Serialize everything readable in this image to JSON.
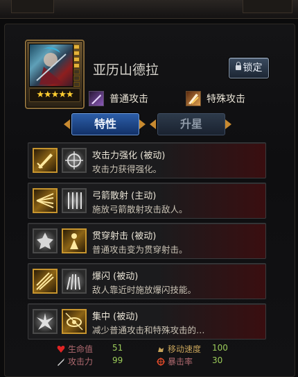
{
  "hero": {
    "name": "亚历山德拉",
    "stars": "★★★★★",
    "level_pips_on": 4,
    "lock_label": "锁定"
  },
  "attack_types": {
    "normal": {
      "label": "普通攻击",
      "icon": "normal-attack-icon"
    },
    "special": {
      "label": "特殊攻击",
      "icon": "special-attack-icon"
    }
  },
  "tabs": [
    {
      "label": "特性",
      "active": true
    },
    {
      "label": "升星",
      "active": false
    }
  ],
  "skills": [
    {
      "name": "攻击力强化 (被动)",
      "desc": "攻击力获得强化。",
      "icon_a": "sword-icon",
      "icon_b": "crosshair-icon"
    },
    {
      "name": "弓箭散射 (主动)",
      "desc": "施放弓箭散射攻击敌人。",
      "icon_a": "arrow-spread-icon",
      "icon_b": "arrow-rain-icon"
    },
    {
      "name": "贯穿射击 (被动)",
      "desc": "普通攻击变为贯穿射击。",
      "icon_a": "shatter-icon",
      "icon_b": "archer-icon"
    },
    {
      "name": "爆闪 (被动)",
      "desc": "敌人靠近时施放爆闪技能。",
      "icon_a": "flash-arrow-icon",
      "icon_b": "burst-icon"
    },
    {
      "name": "集中 (被动)",
      "desc": "减少普通攻击和特殊攻击的…",
      "icon_a": "explosion-icon",
      "icon_b": "eye-focus-icon"
    }
  ],
  "stats": {
    "hp": {
      "label": "生命值",
      "value": "51"
    },
    "atk": {
      "label": "攻击力",
      "value": "99"
    },
    "speed": {
      "label": "移动速度",
      "value": "100"
    },
    "crit": {
      "label": "暴击率",
      "value": "30"
    }
  },
  "colors": {
    "accent_gold": "#c7952e",
    "tab_active": "#2c5ea8",
    "stat_value": "#9ccc5a"
  }
}
